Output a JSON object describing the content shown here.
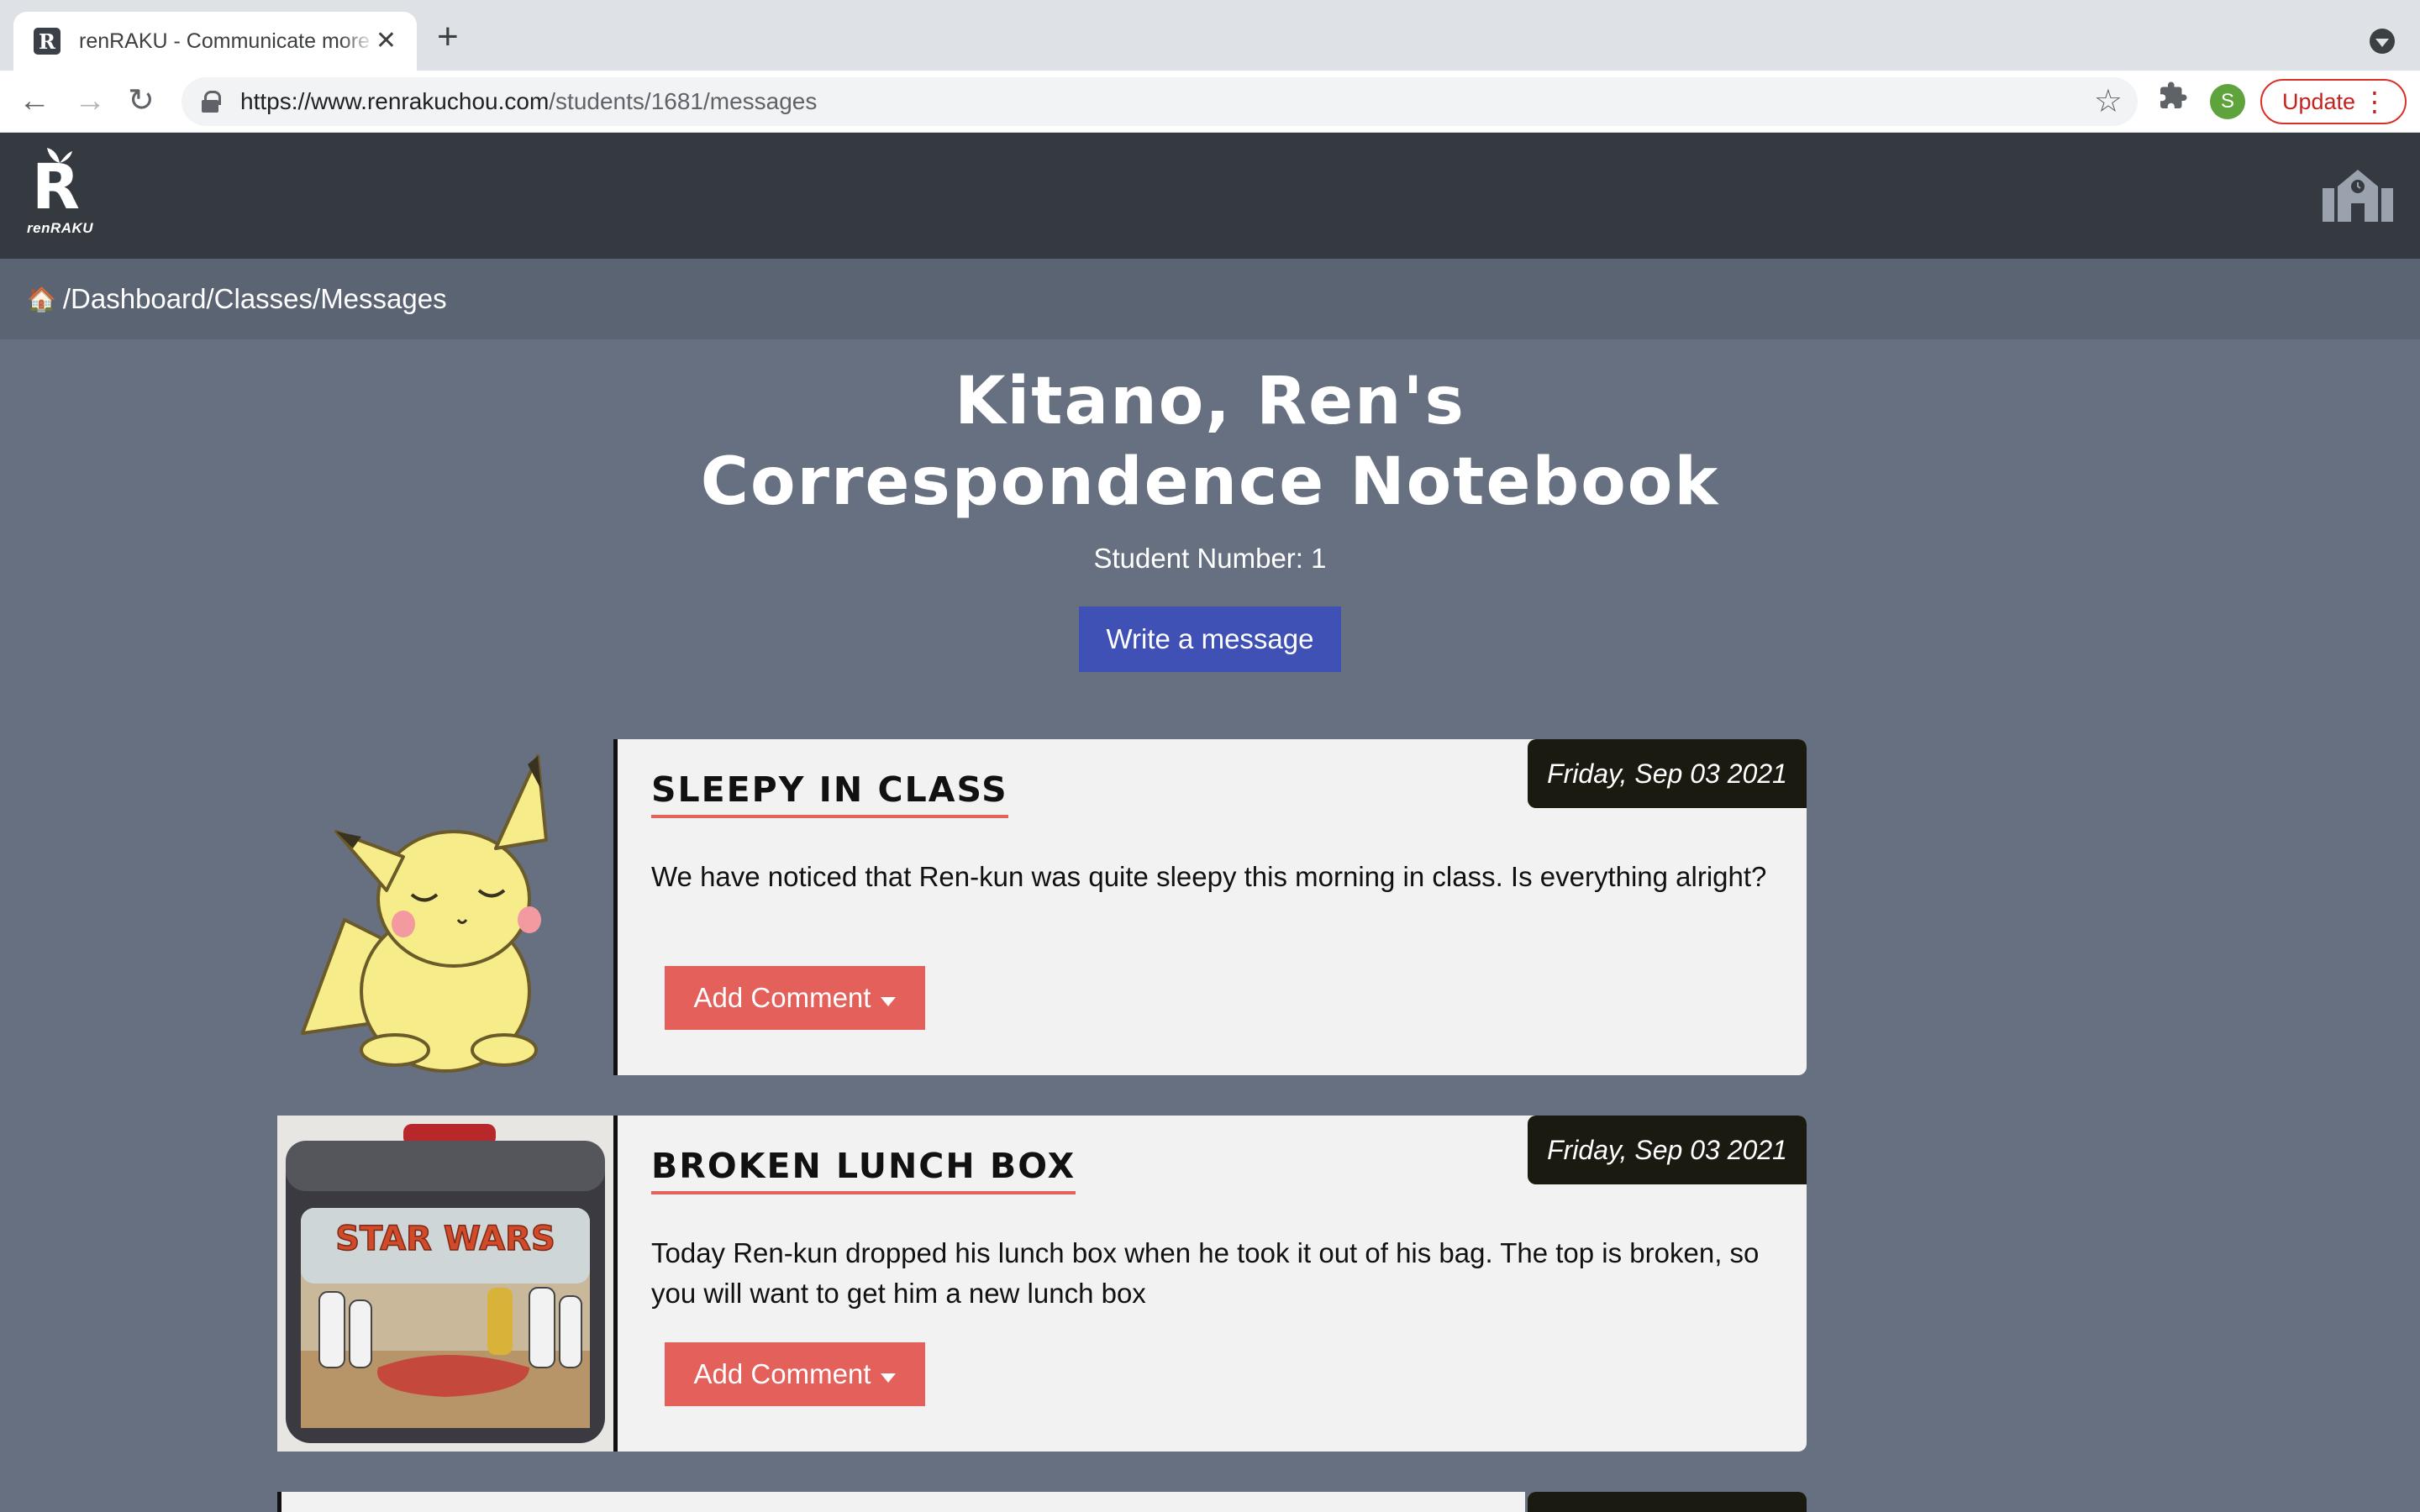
{
  "browser": {
    "tab_title": "renRAKU - Communicate more",
    "tab_favicon_letter": "R",
    "url_host": "https://www.renrakuchou.com",
    "url_path": "/students/1681/messages",
    "profile_initial": "S",
    "update_label": "Update"
  },
  "app": {
    "logo_letter": "R",
    "logo_text": "renRAKU",
    "breadcrumb": "/Dashboard/Classes/Messages"
  },
  "main": {
    "title_line1": "Kitano, Ren's",
    "title_line2": "Correspondence Notebook",
    "student_number": "Student Number: 1",
    "write_button": "Write a message"
  },
  "messages": [
    {
      "date": "Friday, Sep 03 2021",
      "title": "SLEEPY IN CLASS",
      "text": "We have noticed that Ren-kun was quite sleepy this morning in class. Is everything alright?",
      "button": "Add Comment"
    },
    {
      "date": "Friday, Sep 03 2021",
      "title": "BROKEN LUNCH BOX",
      "text": "Today Ren-kun dropped his lunch box when he took it out of his bag. The top is broken, so you will want to get him a new lunch box",
      "button": "Add Comment",
      "image_text": "STAR WARS"
    }
  ],
  "colors": {
    "page_bg": "#667080",
    "header_bg": "#343a40",
    "breadcrumb_bg": "#5b6473",
    "primary": "#3f51b5",
    "accent": "#e4605b",
    "date_bg": "#1b1a10"
  }
}
